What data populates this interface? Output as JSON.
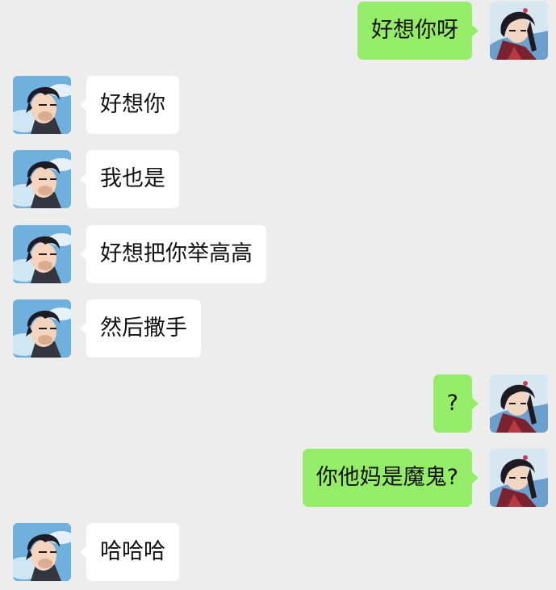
{
  "chat": {
    "messages": [
      {
        "side": "right",
        "text": "好想你呀"
      },
      {
        "side": "left",
        "text": "好想你"
      },
      {
        "side": "left",
        "text": "我也是"
      },
      {
        "side": "left",
        "text": "好想把你举高高"
      },
      {
        "side": "left",
        "text": "然后撒手"
      },
      {
        "side": "right",
        "text": "?"
      },
      {
        "side": "right",
        "text": "你他妈是魔鬼?"
      },
      {
        "side": "left",
        "text": "哈哈哈"
      }
    ]
  },
  "colors": {
    "background": "#ededed",
    "bubble_self": "#95ec69",
    "bubble_other": "#ffffff",
    "text": "#111111"
  }
}
